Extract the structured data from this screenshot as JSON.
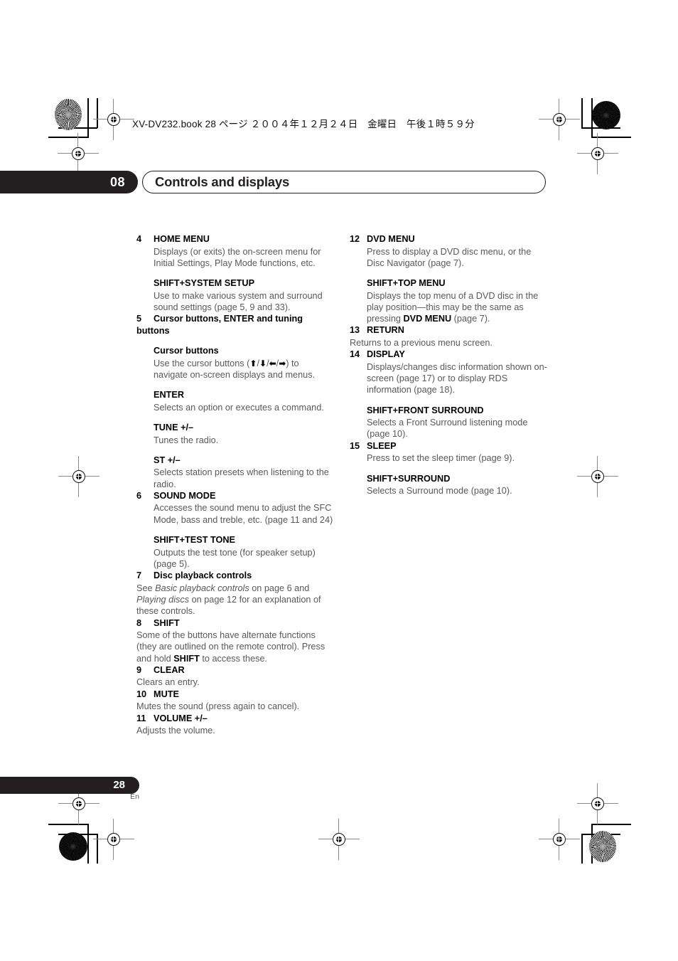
{
  "print_marks": {
    "running_head": "XV-DV232.book  28 ページ  ２００４年１２月２４日　金曜日　午後１時５９分"
  },
  "header": {
    "chapter_number": "08",
    "chapter_title": "Controls and displays"
  },
  "footer": {
    "page_number": "28",
    "language_code": "En"
  },
  "columns": {
    "left": [
      {
        "kind": "numbered",
        "number": "4",
        "label": "HOME MENU",
        "body": "Displays (or exits) the on-screen menu for Initial Settings, Play Mode functions, etc.",
        "body_indent": true,
        "sub": [
          {
            "label": "SHIFT+SYSTEM SETUP",
            "indent": true,
            "body": "Use to make various system and surround sound settings (page 5, 9 and 33).",
            "body_indent": true
          }
        ]
      },
      {
        "kind": "numbered",
        "number": "5",
        "label": "Cursor buttons, ENTER and tuning buttons",
        "label_wrap_flush": true,
        "sub": [
          {
            "label": "Cursor buttons",
            "indent": true,
            "body_html": "Use the cursor buttons (<span class=\"arrow\">⬆</span>/<span class=\"arrow\">⬇</span>/<span class=\"arrow\">⬅</span>/<span class=\"arrow\">➡</span>) to navigate on-screen displays and menus.",
            "body_indent": true
          },
          {
            "label": "ENTER",
            "indent": true,
            "body": "Selects an option or executes a command.",
            "body_indent": true
          },
          {
            "label": "TUNE +/–",
            "indent": true,
            "body": "Tunes the radio.",
            "body_indent": true
          },
          {
            "label": "ST +/–",
            "indent": true,
            "body": "Selects station presets when listening to the radio.",
            "body_indent": true
          }
        ]
      },
      {
        "kind": "numbered",
        "number": "6",
        "label": "SOUND MODE",
        "body": "Accesses the sound menu to adjust the SFC Mode, bass and treble, etc. (page 11 and 24)",
        "body_indent": true,
        "sub": [
          {
            "label": "SHIFT+TEST TONE",
            "indent": true,
            "body": "Outputs the test tone (for speaker setup) (page 5).",
            "body_indent": true
          }
        ]
      },
      {
        "kind": "numbered",
        "number": "7",
        "label": "Disc playback controls",
        "body_html": "See <i>Basic playback controls</i> on page 6 and <i>Playing discs</i> on page 12 for an explanation of these controls.",
        "body_indent": false
      },
      {
        "kind": "numbered",
        "number": "8",
        "label": "SHIFT",
        "body_html": "Some of the buttons have alternate functions (they are outlined on the remote control). Press and hold <b>SHIFT</b> to access these.",
        "body_indent": false
      },
      {
        "kind": "numbered",
        "number": "9",
        "label": "CLEAR",
        "body": "Clears an entry.",
        "body_indent": false
      },
      {
        "kind": "numbered",
        "number": "10",
        "label": "MUTE",
        "body": "Mutes the sound (press again to cancel).",
        "body_indent": false
      },
      {
        "kind": "numbered",
        "number": "11",
        "label": "VOLUME +/–",
        "body": "Adjusts the volume.",
        "body_indent": false
      }
    ],
    "right": [
      {
        "kind": "numbered",
        "number": "12",
        "label": "DVD MENU",
        "body": "Press to display a DVD disc menu, or the Disc Navigator (page 7).",
        "body_indent": true,
        "sub": [
          {
            "label": "SHIFT+TOP MENU",
            "indent": true,
            "body_html": "Displays the top menu of a DVD disc in the play position—this may be the same as pressing <b>DVD MENU</b> (page 7).",
            "body_indent": true
          }
        ]
      },
      {
        "kind": "numbered",
        "number": "13",
        "label": "RETURN",
        "body": "Returns to a previous menu screen.",
        "body_indent": false
      },
      {
        "kind": "numbered",
        "number": "14",
        "label": "DISPLAY",
        "body": "Displays/changes disc information shown on-screen (page 17) or to display RDS information (page 18).",
        "body_indent": true,
        "sub": [
          {
            "label": "SHIFT+FRONT SURROUND",
            "indent": true,
            "body": "Selects a Front Surround listening mode (page 10).",
            "body_indent": true
          }
        ]
      },
      {
        "kind": "numbered",
        "number": "15",
        "label": "SLEEP",
        "body": "Press to set the sleep timer (page 9).",
        "body_indent": true,
        "sub": [
          {
            "label": "SHIFT+SURROUND",
            "indent": true,
            "body": "Selects a Surround mode (page 10).",
            "body_indent": true
          }
        ]
      }
    ]
  }
}
